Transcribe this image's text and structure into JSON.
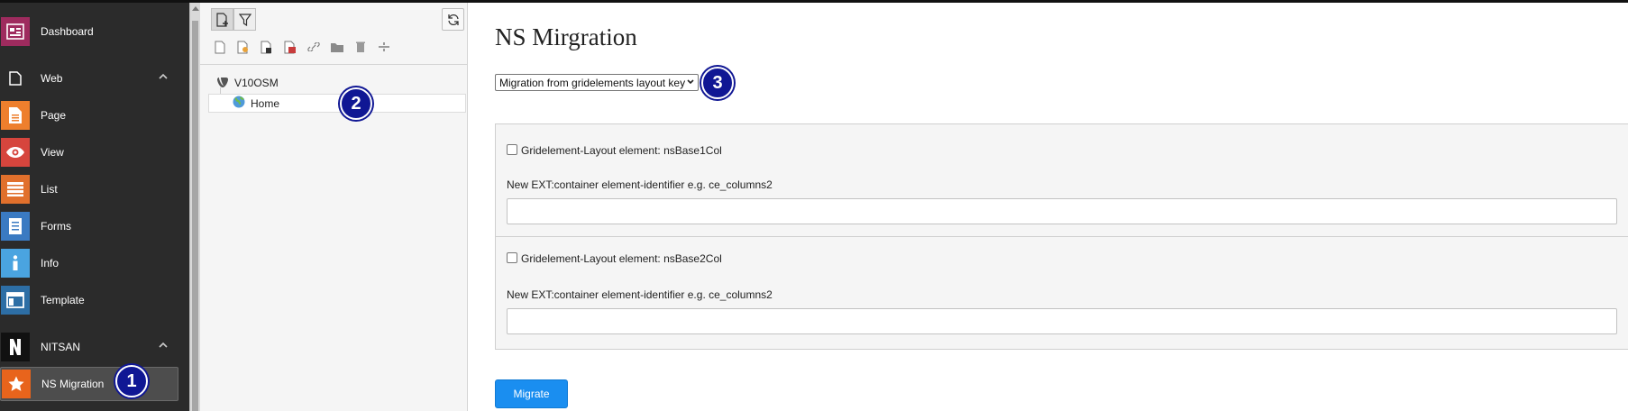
{
  "module_menu": {
    "items": [
      {
        "label": "Dashboard",
        "icon": "dashboard-icon",
        "color": "#9e2b5e"
      },
      {
        "label": "Web",
        "icon": "web-page-icon",
        "color": "#2b2b2b",
        "group": true
      },
      {
        "label": "Page",
        "icon": "page-icon",
        "color": "#ee7f2d"
      },
      {
        "label": "View",
        "icon": "eye-icon",
        "color": "#d6453d"
      },
      {
        "label": "List",
        "icon": "list-icon",
        "color": "#e1702c"
      },
      {
        "label": "Forms",
        "icon": "forms-icon",
        "color": "#3a7ac2"
      },
      {
        "label": "Info",
        "icon": "info-icon",
        "color": "#4aa4e0"
      },
      {
        "label": "Template",
        "icon": "template-icon",
        "color": "#2d6ea5"
      },
      {
        "label": "NITSAN",
        "icon": "nitsan-logo-icon",
        "color": "#111111",
        "group": true
      },
      {
        "label": "NS Migration",
        "icon": "star-icon",
        "color": "#e8641c",
        "active": true
      }
    ]
  },
  "page_tree": {
    "root_label": "V10OSM",
    "home_label": "Home"
  },
  "main": {
    "title": "NS Mirgration",
    "select_value": "Migration from gridelements layout key",
    "rows": [
      {
        "checkbox_label": "Gridelement-Layout element: nsBase1Col",
        "hint": "New EXT:container element-identifier e.g. ce_columns2",
        "value": ""
      },
      {
        "checkbox_label": "Gridelement-Layout element: nsBase2Col",
        "hint": "New EXT:container element-identifier e.g. ce_columns2",
        "value": ""
      }
    ],
    "migrate_label": "Migrate"
  },
  "badges": [
    "1",
    "2",
    "3"
  ],
  "colors": {
    "accent": "#1a8ef0",
    "badge": "#101794",
    "menu_bg": "#2b2b2b"
  }
}
